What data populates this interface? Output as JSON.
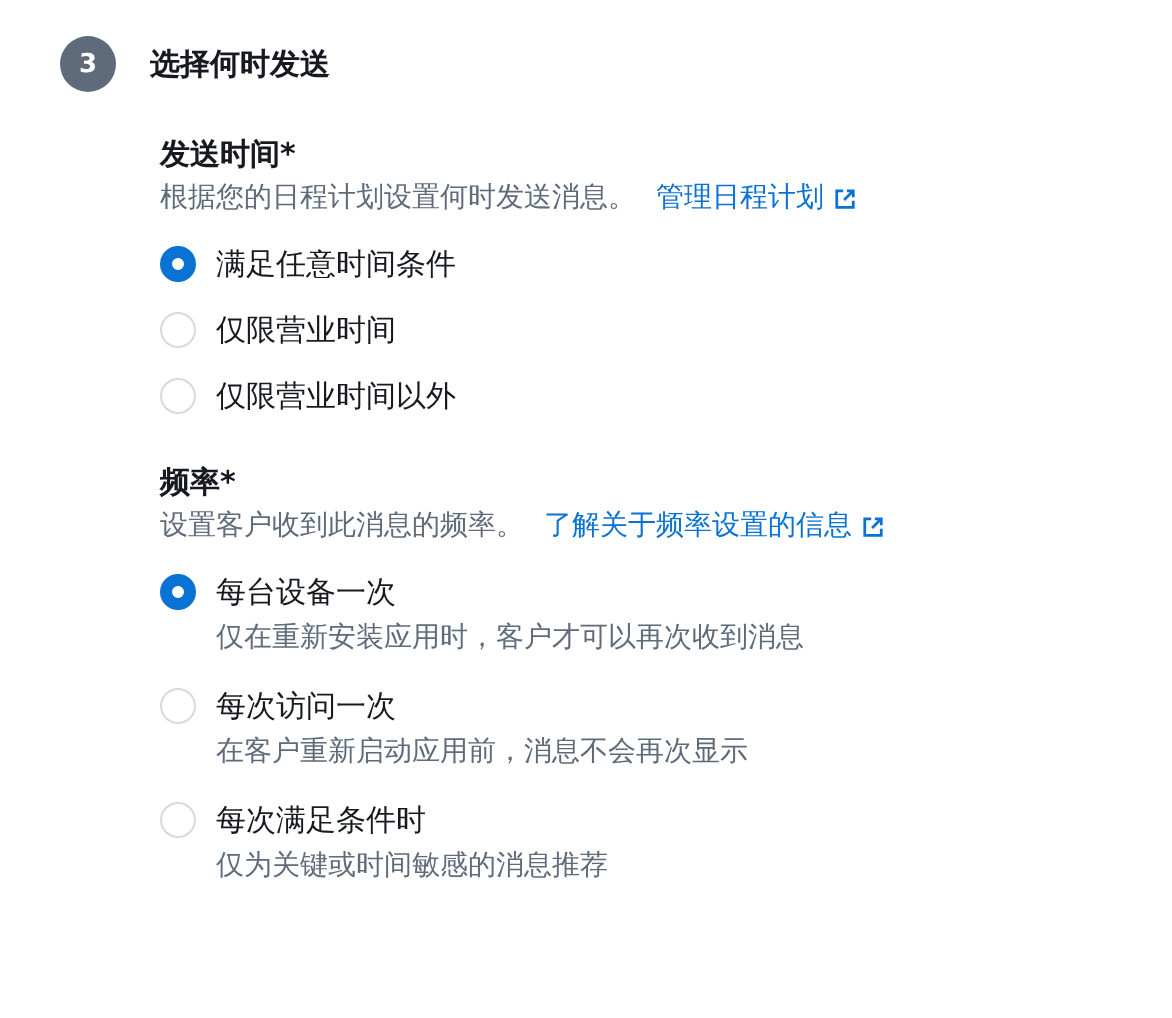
{
  "step": {
    "number": "3",
    "title": "选择何时发送"
  },
  "sections": [
    {
      "label": "发送时间*",
      "description": "根据您的日程计划设置何时发送消息。",
      "link": "管理日程计划",
      "options": [
        {
          "label": "满足任意时间条件",
          "selected": true
        },
        {
          "label": "仅限营业时间",
          "selected": false
        },
        {
          "label": "仅限营业时间以外",
          "selected": false
        }
      ]
    },
    {
      "label": "频率*",
      "description": "设置客户收到此消息的频率。",
      "link": "了解关于频率设置的信息",
      "options": [
        {
          "label": "每台设备一次",
          "hint": "仅在重新安装应用时，客户才可以再次收到消息",
          "selected": true
        },
        {
          "label": "每次访问一次",
          "hint": "在客户重新启动应用前，消息不会再次显示",
          "selected": false
        },
        {
          "label": "每次满足条件时",
          "hint": "仅为关键或时间敏感的消息推荐",
          "selected": false
        }
      ]
    }
  ]
}
